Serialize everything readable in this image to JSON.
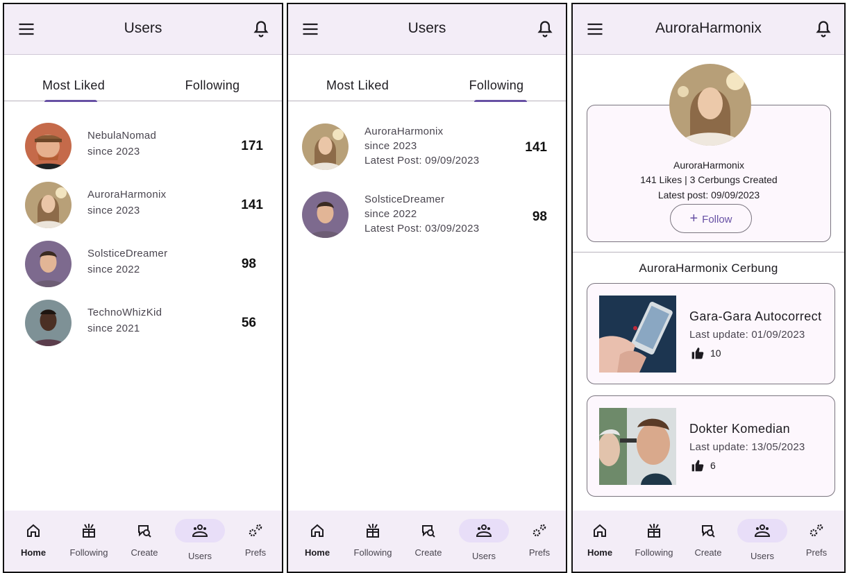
{
  "colors": {
    "appbar_bg": "#f3edf7",
    "accent": "#6750a4",
    "active_pill": "#e8def8",
    "card_bg": "#fdf7fd"
  },
  "nav": {
    "items": [
      {
        "label": "Home",
        "icon": "home-icon"
      },
      {
        "label": "Following",
        "icon": "following-icon"
      },
      {
        "label": "Create",
        "icon": "create-icon"
      },
      {
        "label": "Users",
        "icon": "users-icon"
      },
      {
        "label": "Prefs",
        "icon": "prefs-icon"
      }
    ]
  },
  "screen1": {
    "title": "Users",
    "tabs": [
      {
        "label": "Most Liked"
      },
      {
        "label": "Following"
      }
    ],
    "active_tab": "Most Liked",
    "users": [
      {
        "name": "NebulaNomad",
        "since": "since 2023",
        "score": "171"
      },
      {
        "name": "AuroraHarmonix",
        "since": "since 2023",
        "score": "141"
      },
      {
        "name": "SolsticeDreamer",
        "since": "since 2022",
        "score": "98"
      },
      {
        "name": "TechnoWhizKid",
        "since": "since 2021",
        "score": "56"
      }
    ]
  },
  "screen2": {
    "title": "Users",
    "tabs": [
      {
        "label": "Most Liked"
      },
      {
        "label": "Following"
      }
    ],
    "active_tab": "Following",
    "users": [
      {
        "name": "AuroraHarmonix",
        "since": "since 2023",
        "latest": "Latest Post: 09/09/2023",
        "score": "141"
      },
      {
        "name": "SolsticeDreamer",
        "since": "since 2022",
        "latest": "Latest Post: 03/09/2023",
        "score": "98"
      }
    ]
  },
  "screen3": {
    "title": "AuroraHarmonix",
    "profile": {
      "name": "AuroraHarmonix",
      "stats": "141 Likes | 3 Cerbungs Created",
      "latest": "Latest post: 09/09/2023",
      "follow_label": "Follow"
    },
    "section_title": "AuroraHarmonix Cerbung",
    "stories": [
      {
        "title": "Gara-Gara Autocorrect",
        "update": "Last update: 01/09/2023",
        "likes": "10"
      },
      {
        "title": "Dokter Komedian",
        "update": "Last update: 13/05/2023",
        "likes": "6"
      }
    ]
  }
}
